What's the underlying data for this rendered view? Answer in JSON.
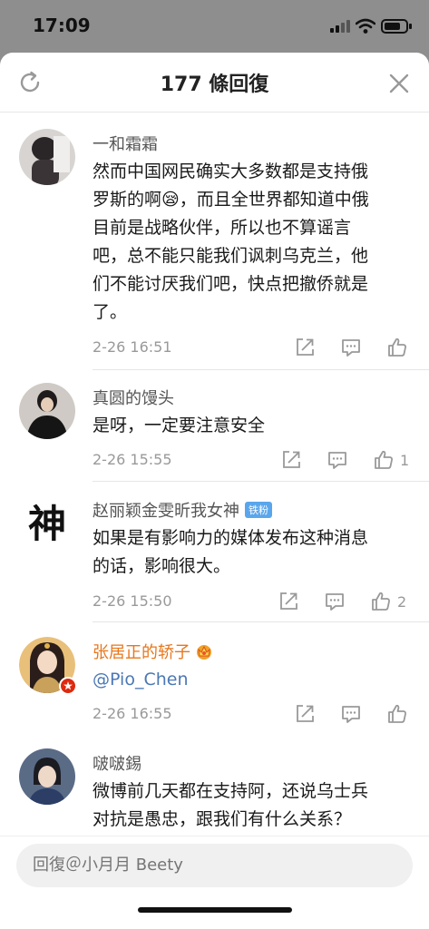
{
  "status_bar": {
    "time": "17:09"
  },
  "header": {
    "title": "177 條回復",
    "refresh_icon": "refresh-icon",
    "close_icon": "close-icon"
  },
  "comments": [
    {
      "username": "一和霜霜",
      "lines": [
        "然而中国网民确实大多数都是支持俄",
        "罗斯的啊😪，而且全世界都知道中俄",
        "目前是战略伙伴，所以也不算谣言",
        "吧，总不能只能我们讽刺乌克兰，他",
        "们不能讨厌我们吧，快点把撤侨就是",
        "了。"
      ],
      "timestamp": "2-26 16:51",
      "likes": ""
    },
    {
      "username": "真圆的馒头",
      "lines": [
        "是呀，一定要注意安全"
      ],
      "timestamp": "2-26 15:55",
      "likes": "1"
    },
    {
      "username": "赵丽颖金雯昕我女神",
      "badge": "铁粉",
      "avatar_text": "神",
      "lines": [
        "如果是有影响力的媒体发布这种消息",
        "的话，影响很大。"
      ],
      "timestamp": "2-26 15:50",
      "likes": "2"
    },
    {
      "username": "张居正的轿子",
      "lines": [
        "@Pio_Chen"
      ],
      "timestamp": "2-26 16:55",
      "likes": ""
    },
    {
      "username": "啵啵錫",
      "lines": [
        "微博前几天都在支持阿，还说乌士兵",
        "对抗是愚忠，跟我们有什么关系？"
      ],
      "timestamp": "",
      "likes": ""
    }
  ],
  "reply": {
    "placeholder": "回復＠小月月 Beety"
  },
  "colors": {
    "accent_orange": "#e8761b",
    "mention_blue": "#4b78b5",
    "badge_blue": "#5aa6ec",
    "meta_gray": "#999999"
  }
}
